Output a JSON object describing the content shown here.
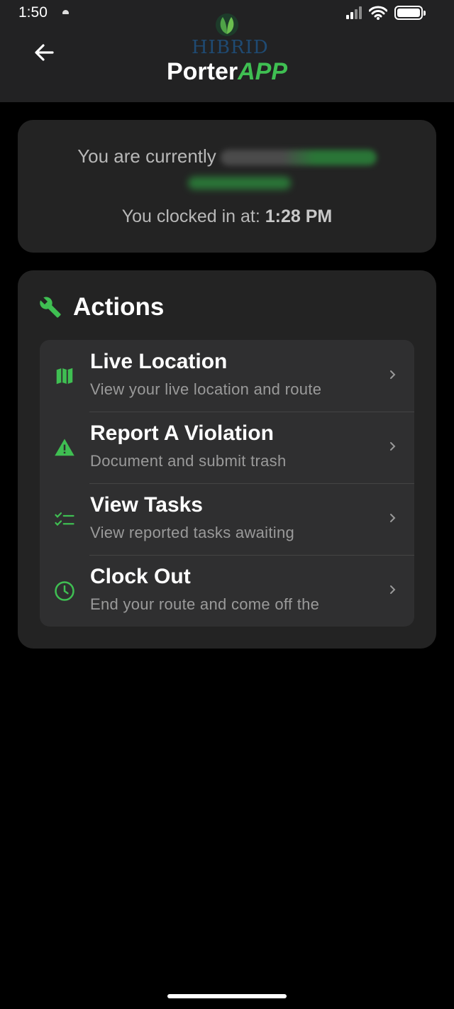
{
  "status_bar": {
    "time": "1:50"
  },
  "header": {
    "logo_text": "HIBRID",
    "title_main": "Porter",
    "title_accent": "APP"
  },
  "status_card": {
    "currently_text": "You are currently",
    "clocked_label": "You clocked in at:",
    "clocked_time": "1:28 PM"
  },
  "actions": {
    "title": "Actions",
    "items": [
      {
        "title": "Live Location",
        "subtitle": "View your live location and route",
        "icon": "map-icon"
      },
      {
        "title": "Report A Violation",
        "subtitle": "Document and submit trash",
        "icon": "warning-icon"
      },
      {
        "title": "View Tasks",
        "subtitle": "View reported tasks awaiting",
        "icon": "checklist-icon"
      },
      {
        "title": "Clock Out",
        "subtitle": "End your route and come off the",
        "icon": "clock-icon"
      }
    ]
  },
  "colors": {
    "accent": "#3fbf52",
    "card": "#232323",
    "list": "#2f2f30",
    "header": "#222223"
  }
}
